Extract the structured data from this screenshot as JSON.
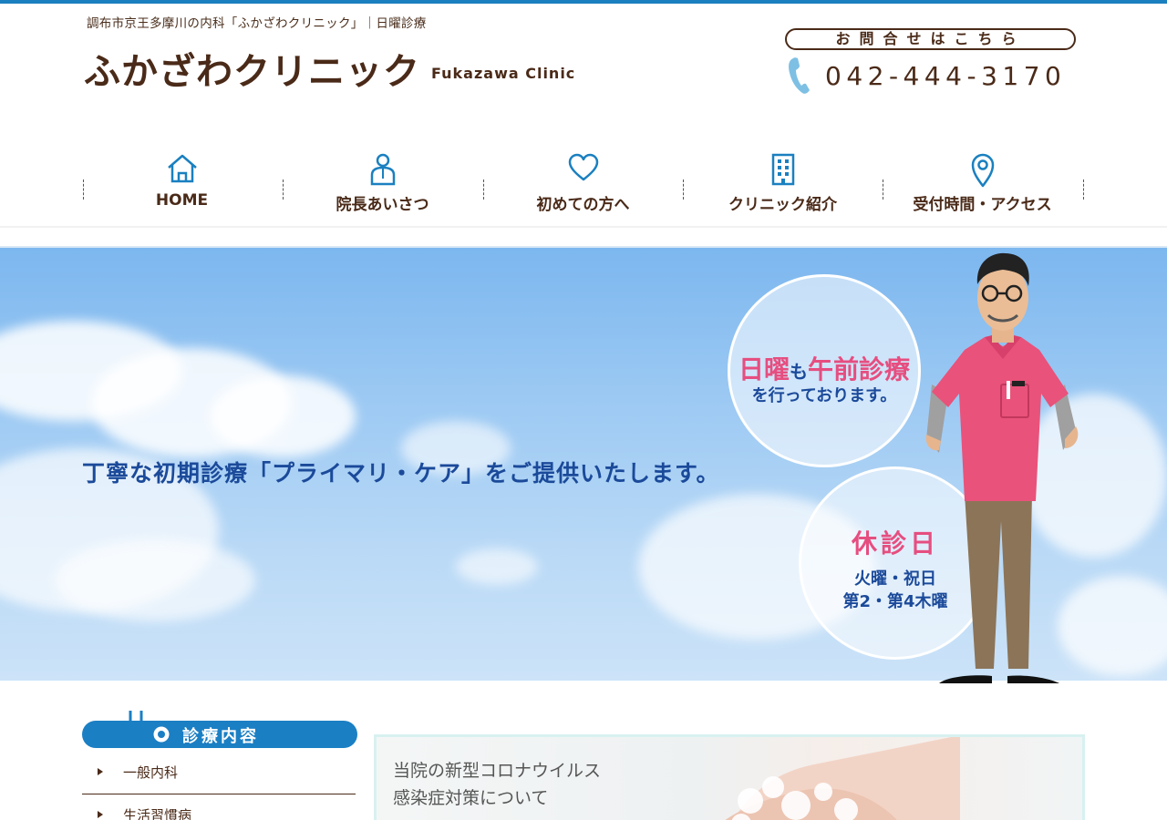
{
  "header": {
    "tagline": "調布市京王多摩川の内科「ふかざわクリニック」｜日曜診療",
    "logo_ja": "ふかざわクリニック",
    "logo_en": "Fukazawa Clinic",
    "contact_label": "お問合せはこちら",
    "phone_number": "042-444-3170"
  },
  "nav": {
    "items": [
      {
        "label": "HOME",
        "icon": "home-icon"
      },
      {
        "label": "院長あいさつ",
        "icon": "doctor-icon"
      },
      {
        "label": "初めての方へ",
        "icon": "heart-icon"
      },
      {
        "label": "クリニック紹介",
        "icon": "building-icon"
      },
      {
        "label": "受付時間・アクセス",
        "icon": "map-pin-icon"
      }
    ]
  },
  "hero": {
    "headline": "丁寧な初期診療「プライマリ・ケア」をご提供いたします。",
    "bubble1": {
      "word1": "日曜",
      "connector": "も",
      "word2": "午前診療",
      "line2": "を行っております。"
    },
    "bubble2": {
      "title": "休診日",
      "line1": "火曜・祝日",
      "line2": "第2・第4木曜"
    }
  },
  "sidebar": {
    "heading": "診療内容",
    "heading_icon": "stethoscope-icon",
    "items": [
      {
        "label": "一般内科"
      },
      {
        "label": "生活習慣病"
      }
    ]
  },
  "main": {
    "notice": {
      "line1": "当院の新型コロナウイルス",
      "line2": "感染症対策について"
    }
  },
  "colors": {
    "accent_blue": "#1b7fc4",
    "brand_brown": "#4a2a18",
    "highlight_pink": "#e64e80",
    "hero_text_blue": "#1b4a9a"
  }
}
